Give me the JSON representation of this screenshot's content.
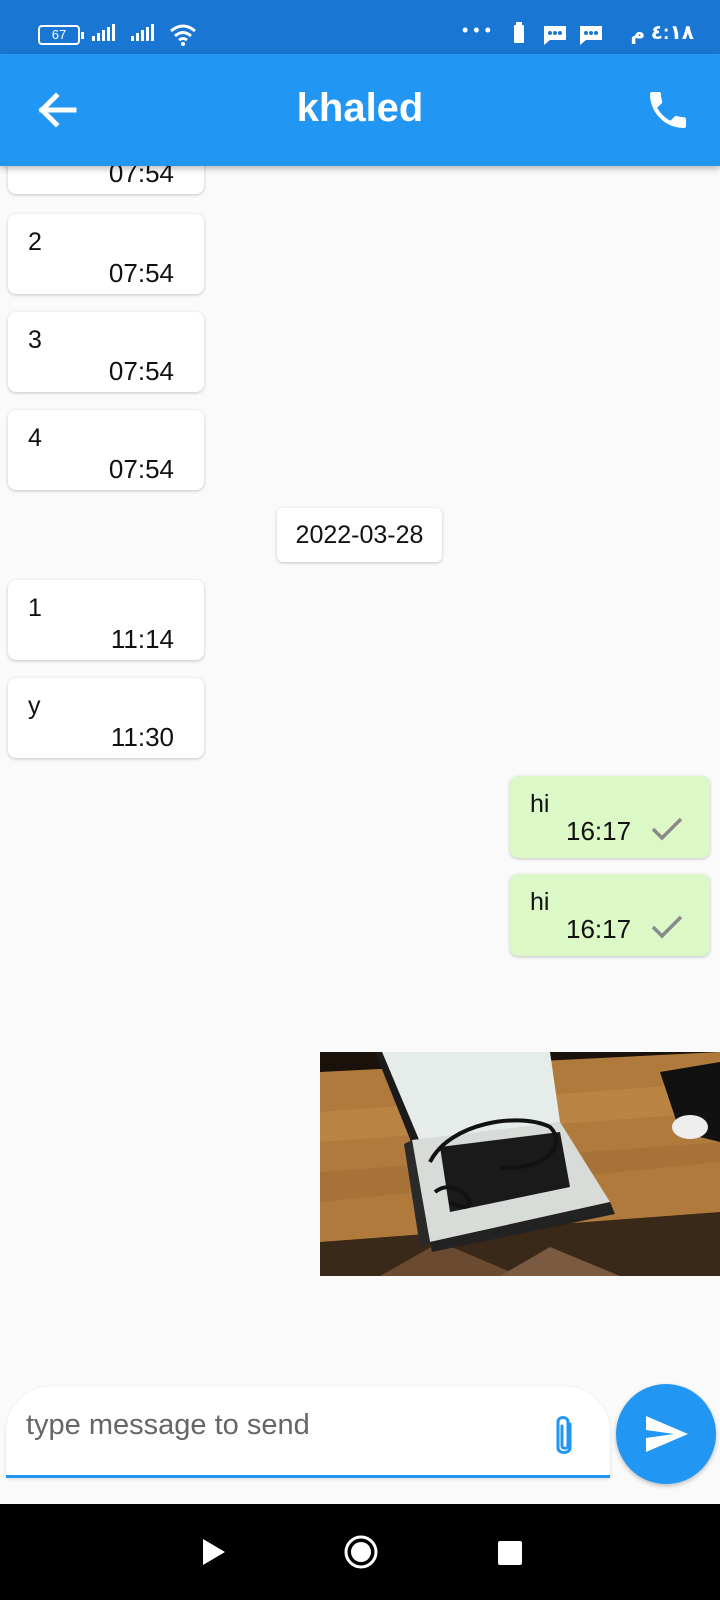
{
  "status_bar": {
    "battery_level": "67",
    "dots": "• • •",
    "time": "٤:١٨ م"
  },
  "header": {
    "title": "khaled",
    "back_icon": "arrow-back-icon",
    "call_icon": "phone-icon"
  },
  "messages": [
    {
      "text": "",
      "time": "07:54"
    },
    {
      "text": "2",
      "time": "07:54"
    },
    {
      "text": "3",
      "time": "07:54"
    },
    {
      "text": "4",
      "time": "07:54"
    },
    {
      "date": "2022-03-28"
    },
    {
      "text": "1",
      "time": "11:14"
    },
    {
      "text": "y",
      "time": "11:30"
    },
    {
      "text": "hi",
      "time": "16:17",
      "sent": true
    },
    {
      "text": "hi",
      "time": "16:17",
      "sent": true
    }
  ],
  "composer": {
    "placeholder": "type message to send",
    "value": "",
    "attach_icon": "paperclip-icon",
    "send_icon": "send-icon"
  },
  "colors": {
    "app_bar": "#2196f3",
    "status_bar": "#1976d2",
    "sent_bubble": "#dcf8c6",
    "received_bubble": "#ffffff"
  }
}
